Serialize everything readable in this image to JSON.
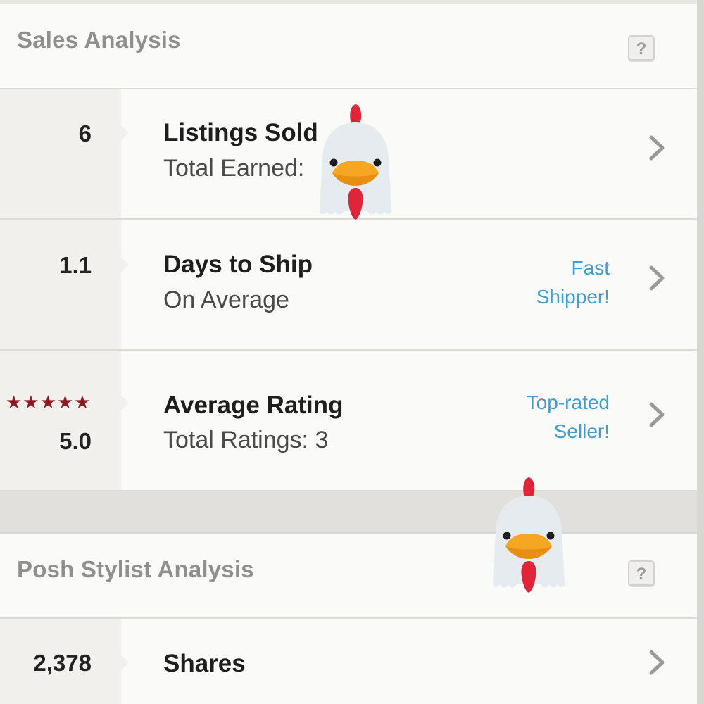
{
  "sales_section": {
    "title": "Sales Analysis",
    "help_label": "?"
  },
  "stats": [
    {
      "value": "6",
      "title": "Listings Sold",
      "subtitle": "Total Earned:",
      "badge": ""
    },
    {
      "value": "1.1",
      "title": "Days to Ship",
      "subtitle": "On Average",
      "badge_line1": "Fast",
      "badge_line2": "Shipper!"
    },
    {
      "value": "5.0",
      "stars": "★★★★★",
      "title": "Average Rating",
      "subtitle": "Total Ratings: 3",
      "badge_line1": "Top-rated",
      "badge_line2": "Seller!"
    }
  ],
  "stylist_section": {
    "title": "Posh Stylist Analysis",
    "help_label": "?"
  },
  "stylist_stats": [
    {
      "value": "2,378",
      "title": "Shares"
    }
  ],
  "icons": {
    "chevron": "chevron-right-icon",
    "mascot": "rooster-icon",
    "help": "question-mark-icon"
  },
  "colors": {
    "link": "#3f9ed0",
    "stars": "#8b1c24"
  }
}
